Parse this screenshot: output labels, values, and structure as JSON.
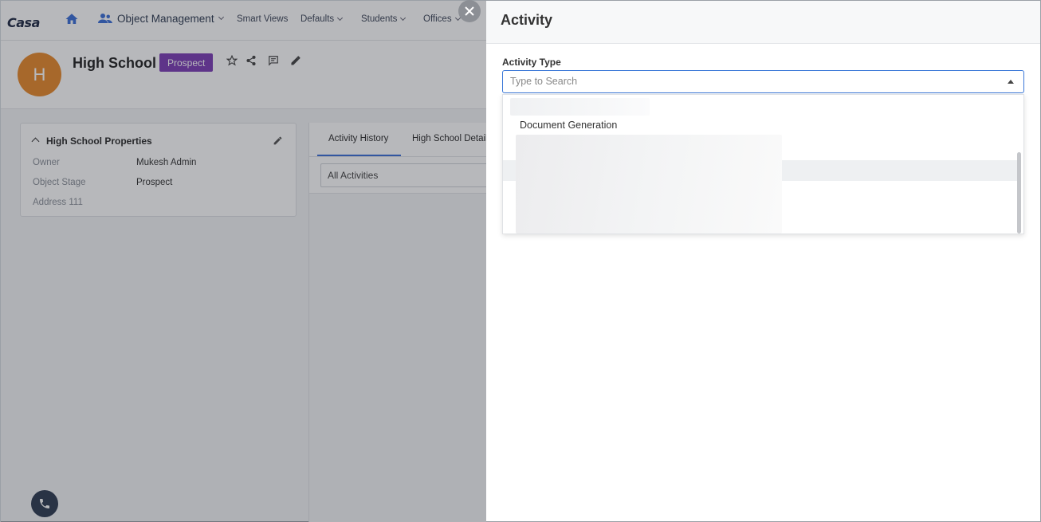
{
  "app": {
    "logo_text": "Casa",
    "nav": {
      "object_management": "Object Management",
      "smart_views": "Smart Views",
      "defaults": "Defaults",
      "students": "Students",
      "offices": "Offices"
    },
    "record": {
      "avatar_letter": "H",
      "title": "High School",
      "stage_badge": "Prospect"
    },
    "properties": {
      "title": "High School Properties",
      "rows": [
        {
          "label": "Owner",
          "value": "Mukesh Admin"
        },
        {
          "label": "Object Stage",
          "value": "Prospect"
        },
        {
          "label": "Address 111",
          "value": ""
        }
      ]
    },
    "tabs": {
      "activity_history": "Activity History",
      "details": "High School Details"
    },
    "activity_filter": "All Activities"
  },
  "drawer": {
    "title": "Activity",
    "field_label": "Activity Type",
    "search_placeholder": "Type to Search",
    "options": {
      "document_generation": "Document Generation"
    }
  },
  "colors": {
    "accent": "#3b78d8",
    "badge": "#7c3db5",
    "avatar": "#e8892b"
  },
  "icons": [
    "home-icon",
    "users-icon",
    "star-icon",
    "share-icon",
    "comment-icon",
    "edit-icon",
    "phone-icon",
    "close-icon",
    "caret-up-icon"
  ]
}
